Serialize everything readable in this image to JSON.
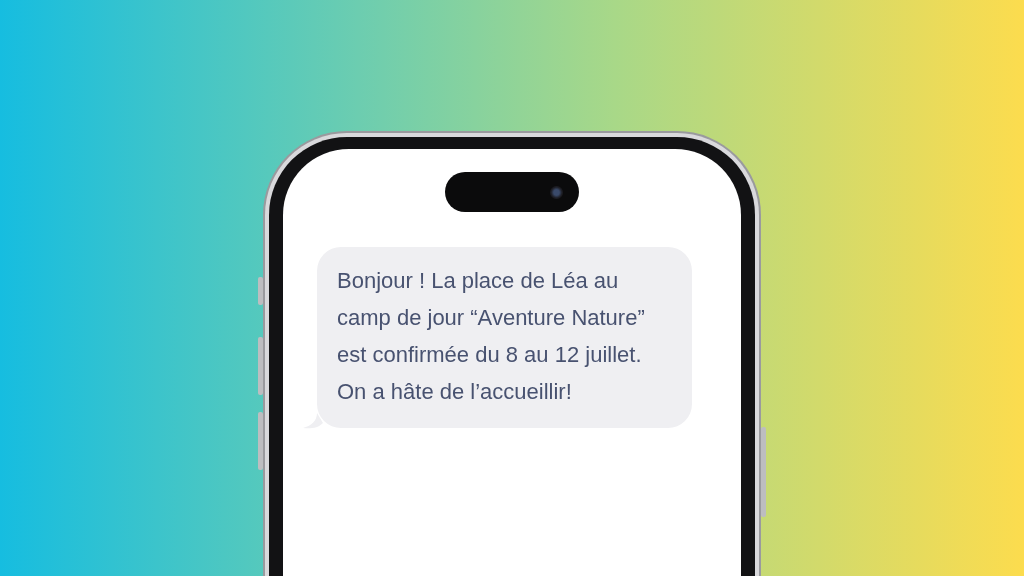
{
  "messages": [
    {
      "text": "Bonjour ! La place de Léa au camp de jour “Aventure Nature” est confirmée du 8 au 12 juillet. On a hâte de l’accueillir!"
    }
  ]
}
